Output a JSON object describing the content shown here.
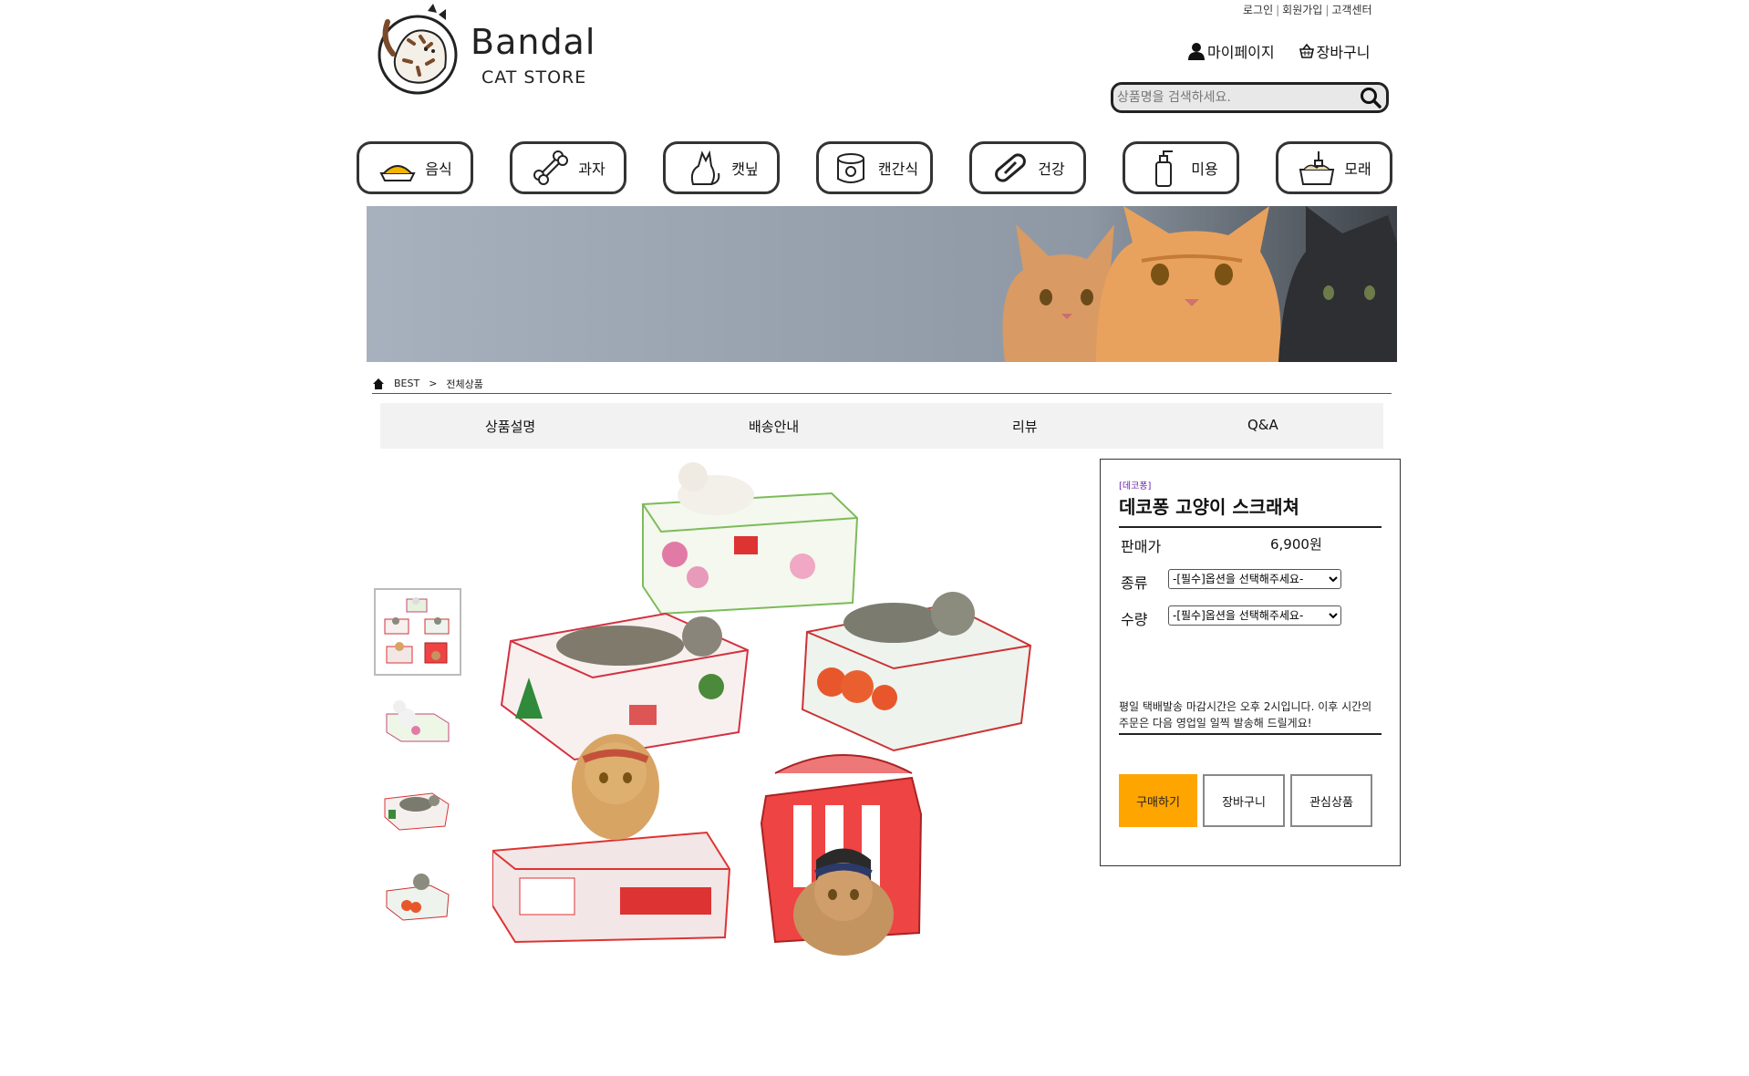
{
  "header": {
    "top_links": [
      "로그인",
      "회원가입",
      "고객센터"
    ],
    "logo_main": "Bandal",
    "logo_sub": "CAT STORE",
    "mypage_label": "마이페이지",
    "cart_label": "장바구니",
    "search_placeholder": "상품명을 검색하세요."
  },
  "categories": [
    {
      "label": "음식",
      "icon": "food-bowl-icon"
    },
    {
      "label": "과자",
      "icon": "bone-icon"
    },
    {
      "label": "캣닢",
      "icon": "cat-icon"
    },
    {
      "label": "캔간식",
      "icon": "can-icon"
    },
    {
      "label": "건강",
      "icon": "pill-icon"
    },
    {
      "label": "미용",
      "icon": "pump-bottle-icon"
    },
    {
      "label": "모래",
      "icon": "litter-box-icon"
    }
  ],
  "breadcrumb": {
    "items": [
      "BEST",
      "전체상품"
    ],
    "separator": ">"
  },
  "tabs": [
    "상품설명",
    "배송안내",
    "리뷰",
    "Q&A"
  ],
  "product": {
    "brand": "[데코퐁]",
    "name": "데코퐁 고양이 스크래쳐",
    "price_label": "판매가",
    "price": "6,900원",
    "type_label": "종류",
    "type_value": "-[필수]옵션을 선택해주세요-",
    "qty_label": "수량",
    "qty_value": "-[필수]옵션을 선택해주세요-",
    "notice": "평일 택배발송 마감시간은 오후 2시입니다. 이후 시간의 주문은 다음 영업일 일찍 발송해 드릴게요!",
    "buy_label": "구매하기",
    "cart_label": "장바구니",
    "wish_label": "관심상품"
  },
  "colors": {
    "accent": "#ffa500",
    "brand_text": "#6a1fb0",
    "tab_bg": "#f2f2f2"
  }
}
